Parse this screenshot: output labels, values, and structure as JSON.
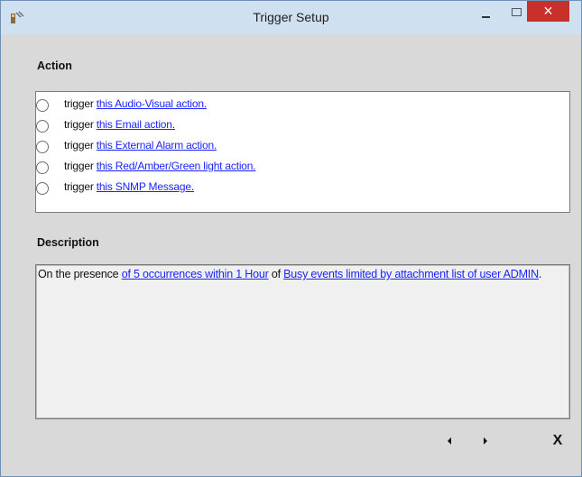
{
  "window": {
    "title": "Trigger Setup",
    "close_glyph": "×",
    "app_icon": "app-icon",
    "colors": {
      "titlebar": "#cfe0f1",
      "close_button": "#c7302b",
      "link": "#1a24ff"
    }
  },
  "action": {
    "heading": "Action",
    "items": [
      {
        "prefix": "trigger",
        "link": "this Audio-Visual action."
      },
      {
        "prefix": "trigger",
        "link": "this Email action."
      },
      {
        "prefix": "trigger",
        "link": "this External Alarm action."
      },
      {
        "prefix": "trigger",
        "link": "this Red/Amber/Green light action."
      },
      {
        "prefix": "trigger",
        "link": "this SNMP Message."
      }
    ]
  },
  "description": {
    "heading": "Description",
    "text_1": "On the presence ",
    "link_1": "of 5 occurrences within 1 Hour",
    "text_2": " of ",
    "link_2": "Busy events limited by attachment list of user ADMIN",
    "text_3": "."
  },
  "footer": {
    "close_label": "X"
  }
}
